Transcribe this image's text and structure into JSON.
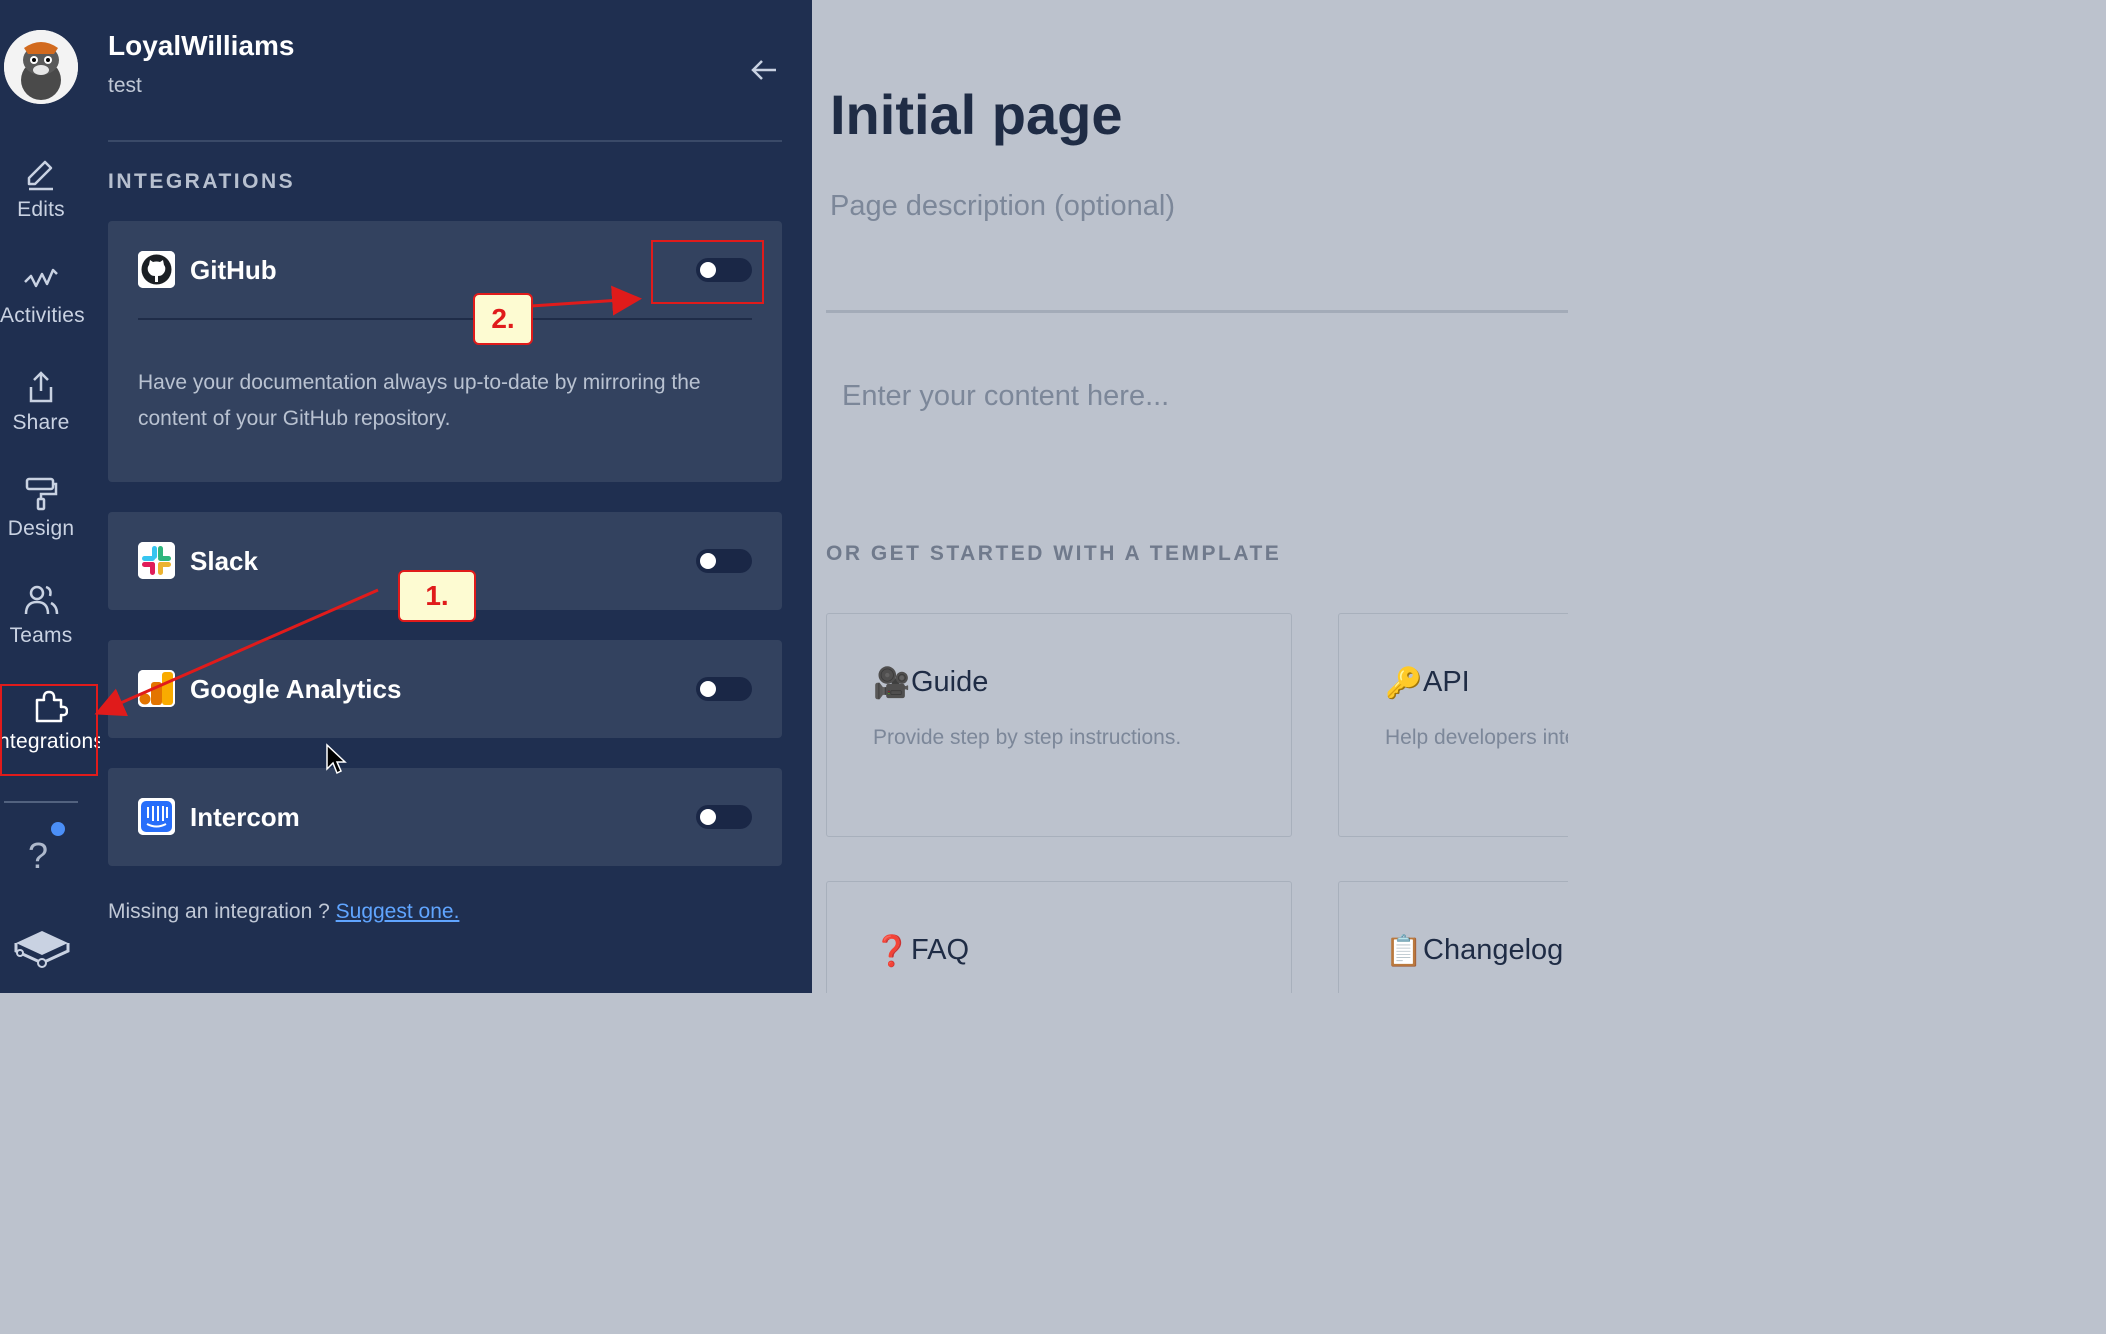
{
  "rail": {
    "items": [
      {
        "label": "Edits",
        "icon": "pencil-icon"
      },
      {
        "label": "Activities",
        "icon": "activity-icon"
      },
      {
        "label": "Share",
        "icon": "share-icon"
      },
      {
        "label": "Design",
        "icon": "paint-roller-icon"
      },
      {
        "label": "Teams",
        "icon": "users-icon"
      },
      {
        "label": "Integrations",
        "icon": "puzzle-icon",
        "active": true
      }
    ],
    "help_label": "?",
    "help_dot_color": "#4b8ff7"
  },
  "panel": {
    "user_name": "LoyalWilliams",
    "user_sub": "test",
    "section_title": "INTEGRATIONS",
    "integrations": [
      {
        "name": "GitHub",
        "enabled": false,
        "description": "Have your documentation always up-to-date by mirroring the content of your GitHub repository."
      },
      {
        "name": "Slack",
        "enabled": false
      },
      {
        "name": "Google Analytics",
        "enabled": false
      },
      {
        "name": "Intercom",
        "enabled": false
      }
    ],
    "missing_text": "Missing an integration ? ",
    "suggest_link": "Suggest one."
  },
  "main": {
    "page_title": "Initial page",
    "page_description_placeholder": "Page description (optional)",
    "content_placeholder": "Enter your content here...",
    "template_heading": "OR GET STARTED WITH A TEMPLATE",
    "templates": [
      {
        "icon": "🎥",
        "title": "Guide",
        "description": "Provide step by step instructions."
      },
      {
        "icon": "🔑",
        "title": "API",
        "description": "Help developers integrate with your API."
      },
      {
        "icon": "❓",
        "title": "FAQ",
        "description": ""
      },
      {
        "icon": "📋",
        "title": "Changelog",
        "description": ""
      }
    ]
  },
  "annotations": {
    "step1": "1.",
    "step2": "2.",
    "color": "#e01b1b"
  }
}
